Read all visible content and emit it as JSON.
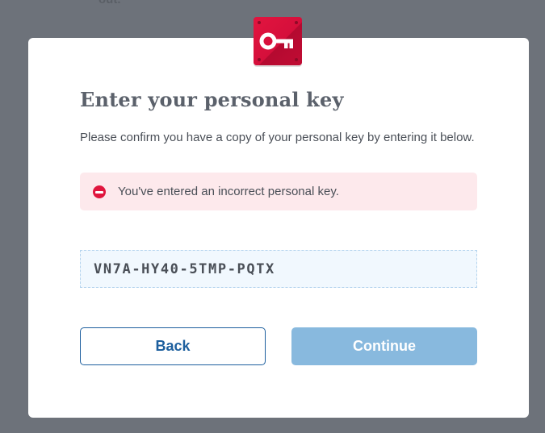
{
  "background": {
    "partial_text": "out."
  },
  "modal": {
    "badge_icon": "key-icon",
    "title": "Enter your personal key",
    "subtitle": "Please confirm you have a copy of your personal key by entering it below.",
    "alert": {
      "icon": "minus-circle-icon",
      "message": "You've entered an incorrect personal key."
    },
    "personal_key_value": "VN7A-HY40-5TMP-PQTX",
    "buttons": {
      "back_label": "Back",
      "continue_label": "Continue"
    }
  },
  "colors": {
    "brand_red": "#e0103f",
    "primary_blue": "#1d5f9e",
    "disabled_blue": "#88b9de",
    "error_bg": "#fde9ec"
  }
}
